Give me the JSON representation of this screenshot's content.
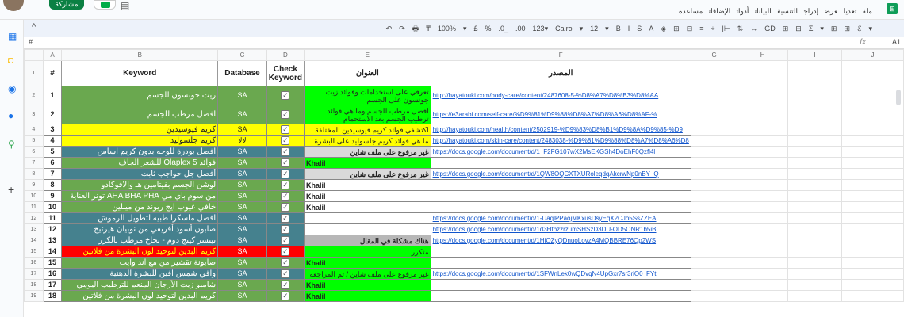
{
  "topbar": {
    "share_label": "مشاركة",
    "chat_icon": "chat-icon",
    "menu": [
      "ملف",
      "تعديل",
      "عرض",
      "إدراج",
      "التنسيق",
      "البيانات",
      "أدوات",
      "الإضافات",
      "مساعدة"
    ],
    "logo_icon": "sheets-logo-icon"
  },
  "toolbar": {
    "tools": [
      "↶",
      "↷",
      "🖶",
      "₸",
      "100%",
      "▾",
      "£",
      "%",
      ".0_",
      ".00",
      "123▾",
      "Cairo",
      "▾",
      "12",
      "▾",
      "B",
      "I",
      "S",
      "A",
      "◈",
      "⊞",
      "⊟",
      "≡",
      "÷",
      "|⊢",
      "⇅",
      "↔",
      "GD",
      "⊞",
      "⊟",
      "Σ",
      "▾",
      "⊞",
      "⊞",
      "ℰ",
      "▾"
    ],
    "font": "Cairo",
    "font_size": "12",
    "zoom": "100%"
  },
  "formula": {
    "cell": "A1",
    "fx": "fx",
    "hash": "#"
  },
  "columns": [
    "A",
    "B",
    "C",
    "D",
    "E",
    "F",
    "G",
    "H",
    "I",
    "J"
  ],
  "header": {
    "row": "1",
    "num": "#",
    "keyword": "Keyword",
    "database": "Database",
    "check": "Check Keyword",
    "title": "العنوان",
    "source": "المصدر"
  },
  "rows": [
    {
      "r": "2",
      "n": "1",
      "kw": "زيت جونسون للجسم",
      "db": "SA",
      "title": "تعرفي على استخدامات وفوائد زيت جونسون على الجسم",
      "src": "http://hayatouki.com/body-care/content/2487608-5-%D8%A7%D8%B3%D8%AA",
      "kwc": "#6aa84f",
      "dbc": "#6aa84f",
      "tc": "#00ff00",
      "tall": true
    },
    {
      "r": "3",
      "n": "2",
      "kw": "افضل مرطب للجسم",
      "db": "SA",
      "title": "افضل مرطب للجسم وما هي فوائد ترطيب الجسم بعد الاستحمام",
      "src": "https://e3arabi.com/self-care/%D9%81%D9%88%D8%A7%D8%A6%D8%AF-%",
      "kwc": "#6aa84f",
      "dbc": "#6aa84f",
      "tc": "#00ff00",
      "tall": true
    },
    {
      "r": "4",
      "n": "3",
      "kw": "كريم فيوسيدين",
      "db": "SA",
      "title": "اكتشفي فوائد كريم فيوسيدين المختلفة",
      "src": "http://hayatouki.com/health/content/2502919-%D9%83%D8%B1%D9%8A%D9%85-%D9",
      "kwc": "#ffff00",
      "dbc": "#ffff00",
      "tc": "#ffff00",
      "tall": false
    },
    {
      "r": "5",
      "n": "4",
      "kw": "كريم جلسوليد",
      "db": "لالا",
      "title": "ما هي فوائد كريم جلسوليد على البشرة",
      "src": "http://hayatouki.com/skin-care/content/2483038-%D9%81%D9%88%D8%A7%D8%A6%D8",
      "kwc": "#ffff00",
      "dbc": "#ffff00",
      "tc": "#ffff00",
      "tall": false
    },
    {
      "r": "6",
      "n": "5",
      "kw": "افضل بودرة للوجه بدون كريم أساس",
      "db": "SA",
      "title": "غير مرفوع على ملف شاين",
      "src": "https://docs.google.com/document/d/1_F2FG107wX2MsEKGSh4DoEhF0Qzfl4l",
      "kwc": "#45818e",
      "dbc": "#45818e",
      "tc": "#d9d9d9",
      "tall": false
    },
    {
      "r": "7",
      "n": "6",
      "kw": "فوائد Olaplex 5 للشعر الجاف",
      "db": "SA",
      "title": "Khalil",
      "src": "",
      "kwc": "#6aa84f",
      "dbc": "#6aa84f",
      "tc": "#00ff00",
      "tall": false,
      "khalil": true
    },
    {
      "r": "8",
      "n": "7",
      "kw": "أفضل جل حواجب ثابت",
      "db": "SA",
      "title": "غير مرفوع على ملف شاين",
      "src": "https://docs.google.com/document/d/1QW8OQCXTXURoleqdqAkcrwNp0nBY_Q",
      "kwc": "#45818e",
      "dbc": "#45818e",
      "tc": "#d9d9d9",
      "tall": false
    },
    {
      "r": "9",
      "n": "8",
      "kw": "لوشن الجسم بفيتامين هـ والافوكادو",
      "db": "SA",
      "title": "Khalil",
      "src": "",
      "kwc": "#6aa84f",
      "dbc": "#6aa84f",
      "tc": "#ffffff",
      "tall": false,
      "khalil": true
    },
    {
      "r": "10",
      "n": "9",
      "kw": "من سوم باي مي AHA BHA PHA تونر العناية",
      "db": "SA",
      "title": "Khalil",
      "src": "",
      "kwc": "#6aa84f",
      "dbc": "#6aa84f",
      "tc": "#ffffff",
      "tall": false,
      "khalil": true
    },
    {
      "r": "11",
      "n": "10",
      "kw": "خافي عيوب ايج ريوند من ميبلين",
      "db": "SA",
      "title": "Khalil",
      "src": "",
      "kwc": "#6aa84f",
      "dbc": "#6aa84f",
      "tc": "#ffffff",
      "tall": false,
      "khalil": true
    },
    {
      "r": "12",
      "n": "11",
      "kw": "افضل ماسكرا طبيه لتطويل الرموش",
      "db": "SA",
      "title": "",
      "src": "https://docs.google.com/document/d/1-UaqlPPaojMKxusDsyEqX2CJo5SsZZEA",
      "kwc": "#45818e",
      "dbc": "#45818e",
      "tc": "#ffffff",
      "tall": false
    },
    {
      "r": "13",
      "n": "12",
      "kw": "صابون أسود أفريقي من نوبيان هيرتيج",
      "db": "SA",
      "title": "",
      "src": "https://docs.google.com/document/d/1d3HtbzzrzumSHSzD3DU-OD5ONR1b5iB",
      "kwc": "#45818e",
      "dbc": "#45818e",
      "tc": "#ffffff",
      "tall": false
    },
    {
      "r": "14",
      "n": "13",
      "kw": "نيتشر كينج دوم - بخاخ مرطب بالكرز",
      "db": "SA",
      "title": "هناك مشكلة في المقال",
      "src": "https://docs.google.com/document/d/1HiOZyQDnuoLovzA4MQBBRE76Qp2WS",
      "kwc": "#45818e",
      "dbc": "#45818e",
      "tc": "#b7b7b7",
      "tall": false
    },
    {
      "r": "15",
      "n": "14",
      "kw": "كريم البدين لتوحيد لون البشرة من فلاتين",
      "db": "SA",
      "title": "متكرر",
      "src": "",
      "kwc": "#ff0000",
      "dbc": "#ff0000",
      "tc": "#00ff00",
      "tall": false
    },
    {
      "r": "16",
      "n": "15",
      "kw": "صابونة تقشير من مع آند وايت",
      "db": "SA",
      "title": "Khalil",
      "src": "",
      "kwc": "#6aa84f",
      "dbc": "#6aa84f",
      "tc": "#00ff00",
      "tall": false,
      "khalil": true
    },
    {
      "r": "17",
      "n": "16",
      "kw": "واقي شمس افين للبشرة الدهنية",
      "db": "SA",
      "title": "غير مرفوع على ملف شاين / تم المراجعة",
      "src": "https://docs.google.com/document/d/1SFWnLek0wQDvqN4UpGxr7sr3riO0_FYt",
      "kwc": "#45818e",
      "dbc": "#45818e",
      "tc": "#00ff00",
      "tall": false
    },
    {
      "r": "18",
      "n": "17",
      "kw": "شامبو زيت الأرجان المنعم للترطيب اليومي",
      "db": "SA",
      "title": "Khalil",
      "src": "",
      "kwc": "#6aa84f",
      "dbc": "#6aa84f",
      "tc": "#00ff00",
      "tall": false,
      "khalil": true
    },
    {
      "r": "19",
      "n": "18",
      "kw": "كريم البدين لتوحيد لون البشرة من فلاتين",
      "db": "SA",
      "title": "Khalil",
      "src": "",
      "kwc": "#6aa84f",
      "dbc": "#6aa84f",
      "tc": "#00ff00",
      "tall": false,
      "khalil": true
    }
  ],
  "colors": {
    "sheets_green": "#0f9d58",
    "link": "#1155cc"
  }
}
